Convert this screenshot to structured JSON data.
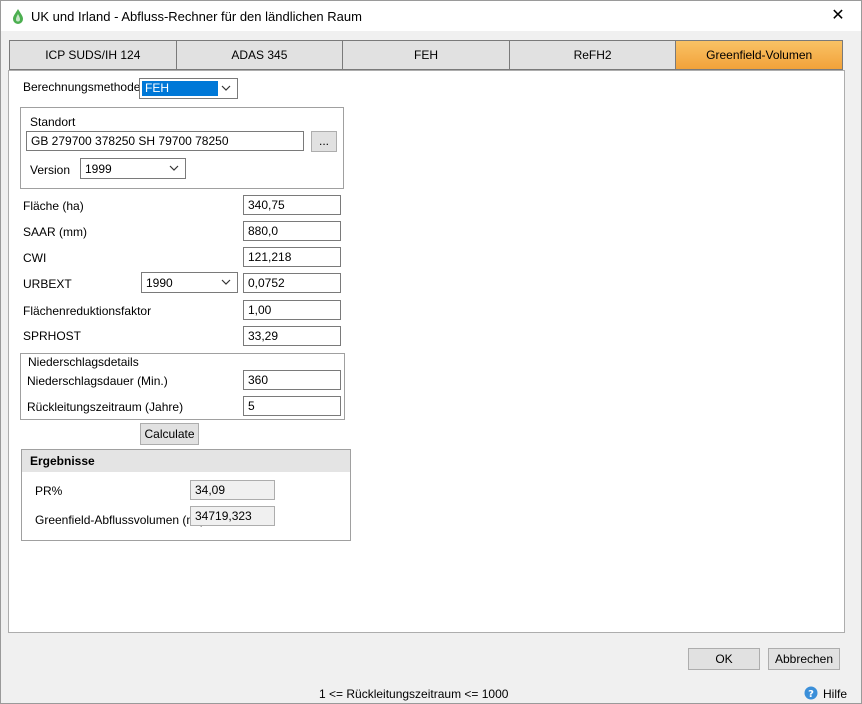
{
  "window": {
    "title": "UK und Irland - Abfluss-Rechner für den ländlichen Raum",
    "close": "✕"
  },
  "tabs": [
    {
      "label": "ICP SUDS/IH 124"
    },
    {
      "label": "ADAS 345"
    },
    {
      "label": "FEH"
    },
    {
      "label": "ReFH2"
    },
    {
      "label": "Greenfield-Volumen",
      "active": true
    }
  ],
  "method": {
    "label": "Berechnungsmethode",
    "value": "FEH"
  },
  "location": {
    "group_label": "Standort",
    "value": "GB 279700 378250 SH 79700 78250",
    "browse_label": "...",
    "version_label": "Version",
    "version_value": "1999"
  },
  "fields": {
    "area_label": "Fläche (ha)",
    "area_value": "340,75",
    "saar_label": "SAAR (mm)",
    "saar_value": "880,0",
    "cwi_label": "CWI",
    "cwi_value": "121,218",
    "urbext_label": "URBEXT",
    "urbext_year": "1990",
    "urbext_value": "0,0752",
    "arf_label": "Flächenreduktionsfaktor",
    "arf_value": "1,00",
    "sprhost_label": "SPRHOST",
    "sprhost_value": "33,29"
  },
  "rainfall": {
    "group_label": "Niederschlagsdetails",
    "duration_label": "Niederschlagsdauer (Min.)",
    "duration_value": "360",
    "return_label": "Rückleitungszeitraum (Jahre)",
    "return_value": "5"
  },
  "calculate_label": "Calculate",
  "results": {
    "header": "Ergebnisse",
    "pr_label": "PR%",
    "pr_value": "34,09",
    "volume_label": "Greenfield-Abflussvolumen (m³)",
    "volume_value": "34719,323"
  },
  "footer": {
    "ok_label": "OK",
    "cancel_label": "Abbrechen",
    "status_text": "1 <= Rückleitungszeitraum <= 1000",
    "help_label": "Hilfe"
  },
  "colors": {
    "active_tab": "#f2a23a",
    "selection": "#0078d7",
    "help_icon": "#3b8fd9"
  }
}
